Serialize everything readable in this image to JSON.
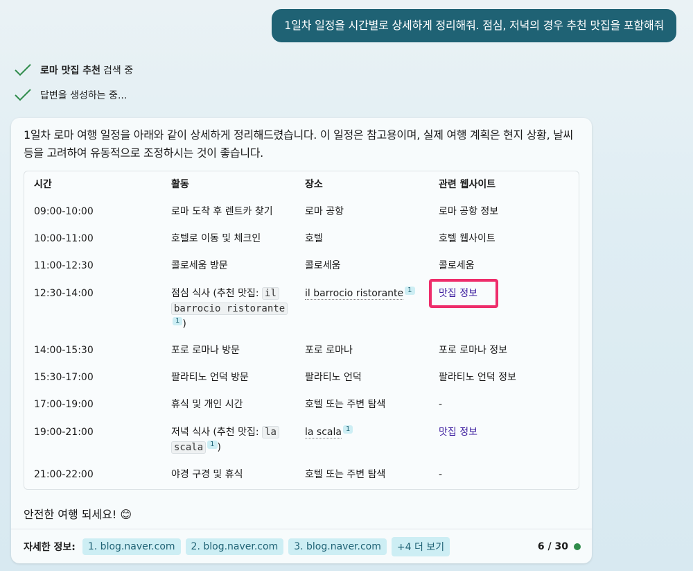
{
  "user_message": "1일차 일정을 시간별로 상세하게 정리해줘. 점심, 저녁의 경우 추천 맛집을 포함해줘",
  "status": [
    {
      "bold": "로마 맛집 추천",
      "text": "검색 중",
      "icon": "check-icon"
    },
    {
      "bold": "",
      "text": "답변을 생성하는 중...",
      "icon": "check-icon"
    }
  ],
  "intro": "1일차 로마 여행 일정을 아래와 같이 상세하게 정리해드렸습니다. 이 일정은 참고용이며, 실제 여행 계획은 현지 상황, 날씨 등을 고려하여 유동적으로 조정하시는 것이 좋습니다.",
  "table": {
    "headers": [
      "시간",
      "활동",
      "장소",
      "관련 웹사이트"
    ],
    "rows": [
      {
        "time": "09:00-10:00",
        "activity": "로마 도착 후 렌트카 찾기",
        "place": "로마 공항",
        "site": "로마 공항 정보"
      },
      {
        "time": "10:00-11:00",
        "activity": "호텔로 이동 및 체크인",
        "place": "호텔",
        "site": "호텔 웹사이트"
      },
      {
        "time": "11:00-12:30",
        "activity": "콜로세움 방문",
        "place": "콜로세움",
        "site": "콜로세움"
      },
      {
        "time": "12:30-14:00",
        "activity_prefix": "점심 식사 (추천 맛집: ",
        "activity_code1": "il",
        "activity_code2": "barrocio ristorante",
        "activity_suffix": ")",
        "place": "il barrocio ristorante",
        "site": "맛집 정보",
        "cite": "1"
      },
      {
        "time": "14:00-15:30",
        "activity": "포로 로마나 방문",
        "place": "포로 로마나",
        "site": "포로 로마나 정보"
      },
      {
        "time": "15:30-17:00",
        "activity": "팔라티노 언덕 방문",
        "place": "팔라티노 언덕",
        "site": "팔라티노 언덕 정보"
      },
      {
        "time": "17:00-19:00",
        "activity": "휴식 및 개인 시간",
        "place": "호텔 또는 주변 탐색",
        "site": "-"
      },
      {
        "time": "19:00-21:00",
        "activity_prefix": "저녁 식사 (추천 맛집: ",
        "activity_code1": "la",
        "activity_code2": "scala",
        "activity_suffix": ")",
        "place": "la scala",
        "site": "맛집 정보",
        "cite": "1"
      },
      {
        "time": "21:00-22:00",
        "activity": "야경 구경 및 휴식",
        "place": "호텔 또는 주변 탐색",
        "site": "-"
      }
    ]
  },
  "closing": "안전한 여행 되세요! 😊",
  "footer": {
    "label": "자세한 정보:",
    "chips": [
      "1. blog.naver.com",
      "2. blog.naver.com",
      "3. blog.naver.com",
      "+4 더 보기"
    ],
    "counter": "6 / 30"
  },
  "colors": {
    "user_bubble": "#1f6274",
    "chip_bg": "#cdeef4",
    "highlight": "#ee2d6b",
    "link": "#3a1b9e",
    "status_dot": "#2e8b4a"
  }
}
